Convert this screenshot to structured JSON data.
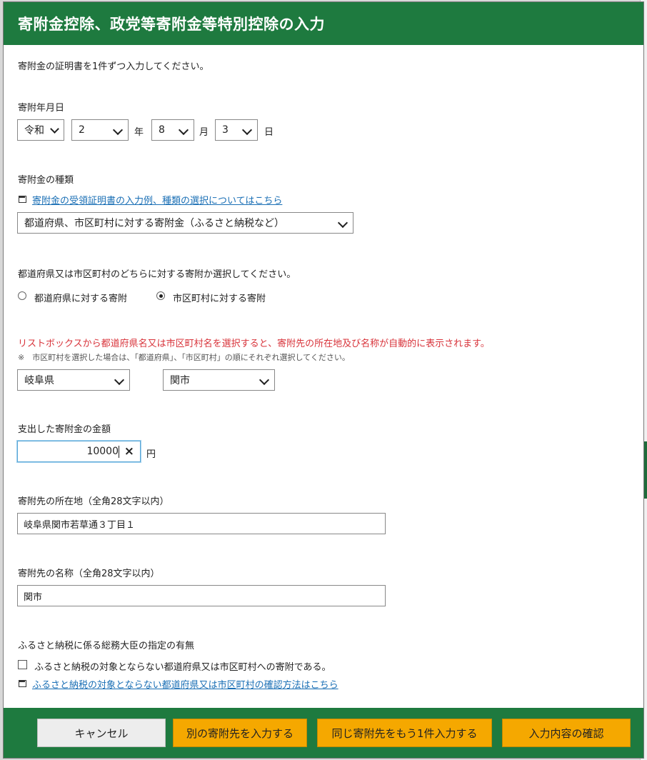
{
  "dialog": {
    "title": "寄附金控除、政党等寄附金等特別控除の入力",
    "intro": "寄附金の証明書を1件ずつ入力してください。"
  },
  "date": {
    "label": "寄附年月日",
    "era": "令和",
    "year": "2",
    "year_unit": "年",
    "month": "8",
    "month_unit": "月",
    "day": "3",
    "day_unit": "日"
  },
  "donation_type": {
    "label": "寄附金の種類",
    "help_link": "寄附金の受領証明書の入力例、種類の選択についてはこちら",
    "selected": "都道府県、市区町村に対する寄附金（ふるさと納税など）"
  },
  "recipient_type": {
    "question": "都道府県又は市区町村のどちらに対する寄附か選択してください。",
    "options": [
      {
        "label": "都道府県に対する寄附",
        "selected": false
      },
      {
        "label": "市区町村に対する寄附",
        "selected": true
      }
    ]
  },
  "location_select": {
    "warning": "リストボックスから都道府県名又は市区町村名を選択すると、寄附先の所在地及び名称が自動的に表示されます。",
    "note": "※　市区町村を選択した場合は、「都道府県」、「市区町村」の順にそれぞれ選択してください。",
    "prefecture": "岐阜県",
    "municipality": "関市"
  },
  "amount": {
    "label": "支出した寄附金の金額",
    "value": "10000",
    "clear_icon": "×",
    "unit": "円"
  },
  "address": {
    "label": "寄附先の所在地（全角28文字以内）",
    "value": "岐阜県関市若草通３丁目１"
  },
  "name": {
    "label": "寄附先の名称（全角28文字以内）",
    "value": "関市"
  },
  "furusato": {
    "label": "ふるさと納税に係る総務大臣の指定の有無",
    "checkbox_label": "ふるさと納税の対象とならない都道府県又は市区町村への寄附である。",
    "checked": false,
    "help_link": "ふるさと納税の対象とならない都道府県又は市区町村の確認方法はこちら"
  },
  "footer": {
    "cancel": "キャンセル",
    "another_recipient": "別の寄附先を入力する",
    "same_recipient": "同じ寄附先をもう1件入力する",
    "confirm": "入力内容の確認"
  },
  "colors": {
    "header_green": "#1e7a3f",
    "button_orange": "#f5a800",
    "warning_red": "#d8333a",
    "link_blue": "#1a6fb5"
  }
}
